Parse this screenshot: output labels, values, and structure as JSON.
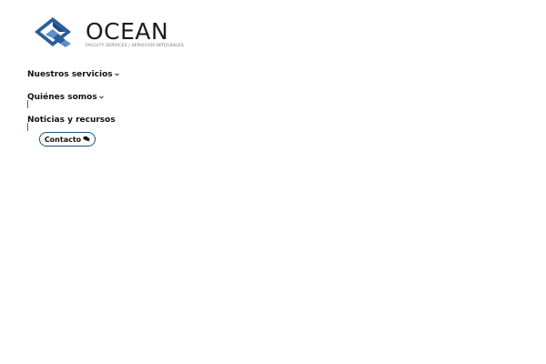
{
  "brand": {
    "name": "OCEAN",
    "tagline": "FACILITY SERVICES | SERVICIOS INTEGRALES",
    "logo_icon": "ocean-diamond-logo-icon",
    "colors": {
      "primary": "#2a5d9c",
      "light": "#5e8fcc",
      "dark": "#1b1c1e"
    }
  },
  "nav": {
    "items": [
      {
        "label": "Nuestros servicios",
        "has_dropdown": true,
        "icon": "chevron-down-icon"
      },
      {
        "label": "Quiénes somos",
        "has_dropdown": true,
        "icon": "chevron-down-icon"
      },
      {
        "label": "Noticias y recursos",
        "has_dropdown": false
      }
    ]
  },
  "contact_button": {
    "label": "Contacto",
    "icon": "chat-bubble-icon",
    "border_color": "#1f4f82"
  }
}
